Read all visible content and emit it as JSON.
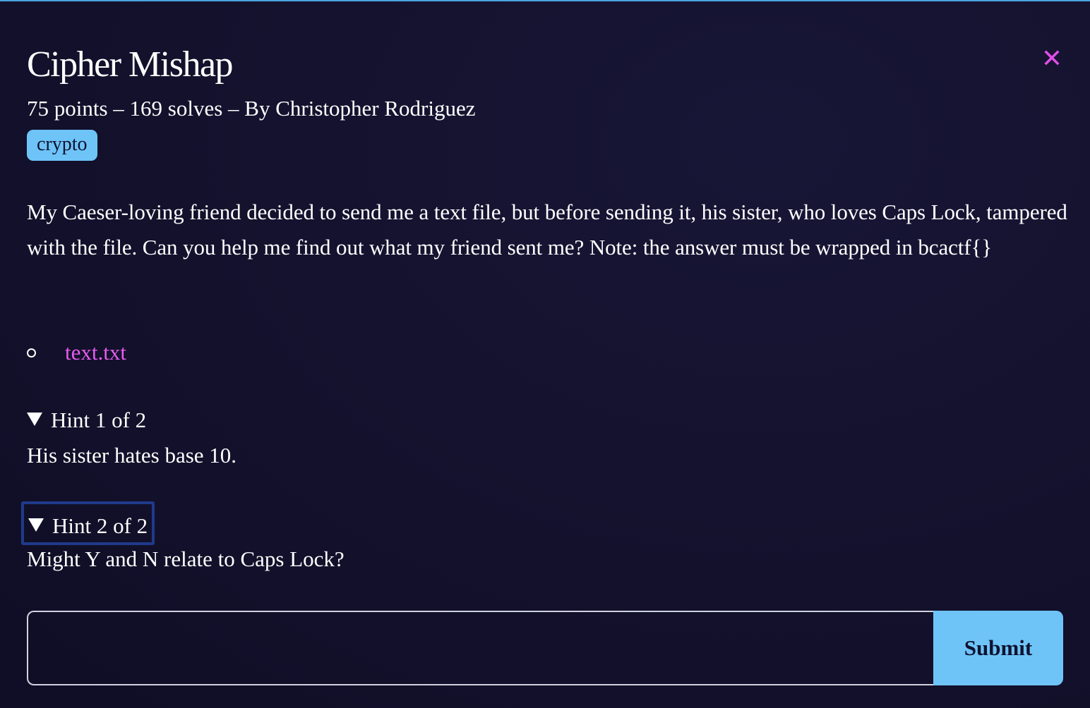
{
  "challenge": {
    "title": "Cipher Mishap",
    "meta": "75 points – 169 solves – By Christopher Rodriguez",
    "tag": "crypto",
    "description": "My Caeser-loving friend decided to send me a text file, but before sending it, his sister, who loves Caps Lock, tampered with the file. Can you help me find out what my friend sent me? Note: the answer must be wrapped in bcactf{}",
    "files": [
      {
        "name": "text.txt"
      }
    ],
    "hints": [
      {
        "summary": "Hint 1 of 2",
        "body": "His sister hates base 10."
      },
      {
        "summary": "Hint 2 of 2",
        "body": "Might Y and N relate to Caps Lock?"
      }
    ]
  },
  "form": {
    "input_value": "",
    "input_placeholder": "",
    "submit_label": "Submit"
  },
  "icons": {
    "close": "close-icon",
    "bullet": "circle-bullet-icon",
    "disclosure": "triangle-down-icon"
  },
  "colors": {
    "background": "#13112c",
    "accent_blue": "#6ec4f7",
    "link_pink": "#e85cf0",
    "close_pink": "#e04ee8",
    "focus_outline": "#1f3a8a"
  }
}
